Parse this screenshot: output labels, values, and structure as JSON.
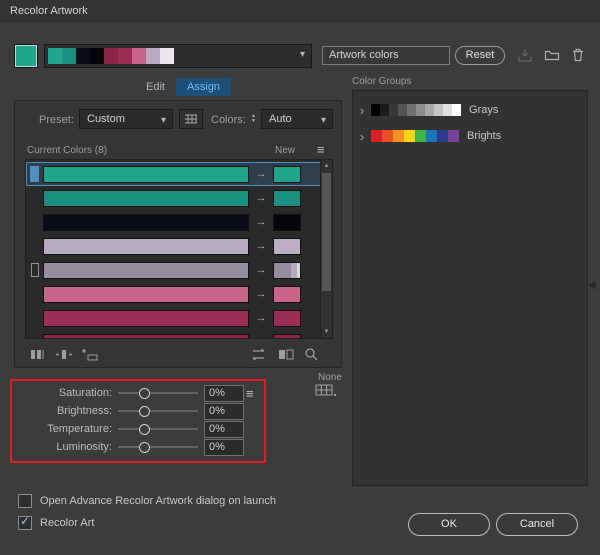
{
  "window": {
    "title": "Recolor Artwork"
  },
  "icons": {
    "row_arrow": "→",
    "menu": "≡",
    "chevron_down": "▾",
    "chevron_right": "›",
    "scroll_up": "▲",
    "scroll_down": "▼",
    "stepper_up": "▲",
    "stepper_down": "▼",
    "collapse_left": "◀",
    "check": "✓"
  },
  "toolbar": {
    "selected_swatch": "#21a48c",
    "palette": [
      "#21a48c",
      "#1b9181",
      "#0a0d17",
      "#04060c",
      "#8e2348",
      "#9c2d56",
      "#c9648b",
      "#b7abc0",
      "#ece7ef"
    ],
    "artwork_colors": "Artwork colors",
    "reset": "Reset"
  },
  "tabs": {
    "edit": "Edit",
    "assign": "Assign"
  },
  "preset": {
    "label": "Preset:",
    "value": "Custom",
    "colors_label": "Colors:",
    "colors_value": "Auto"
  },
  "assign": {
    "header": "Current Colors (8)",
    "new_header": "New",
    "rows": [
      {
        "color": "#21a48c",
        "new": "#21a48c",
        "selected": true
      },
      {
        "color": "#1b9181",
        "new": "#1b9181"
      },
      {
        "color": "#0a0d17",
        "new": "#04060c"
      },
      {
        "color": "#b7abc0",
        "new": "#bcb0c5"
      },
      {
        "color": "#958c9d",
        "new": "#958c9d",
        "split": "#b3a9bb",
        "grip": true
      },
      {
        "color": "#c9648b",
        "new": "#c9648b"
      },
      {
        "color": "#9c2d56",
        "new": "#9c2d56"
      },
      {
        "color": "#8e2348",
        "new": "#8e2348"
      }
    ]
  },
  "sliders": {
    "rows": [
      {
        "label": "Saturation:",
        "value": "0%"
      },
      {
        "label": "Brightness:",
        "value": "0%"
      },
      {
        "label": "Temperature:",
        "value": "0%"
      },
      {
        "label": "Luminosity:",
        "value": "0%"
      }
    ]
  },
  "color_groups": {
    "title": "Color Groups",
    "none_label": "None",
    "groups": [
      {
        "name": "Grays",
        "swatches": [
          "#000000",
          "#1c1c1c",
          "#383838",
          "#545454",
          "#707070",
          "#8c8c8c",
          "#a8a8a8",
          "#c4c4c4",
          "#e0e0e0",
          "#ffffff"
        ]
      },
      {
        "name": "Brights",
        "swatches": [
          "#d92027",
          "#ef4e23",
          "#f7941e",
          "#ffd40e",
          "#3db54a",
          "#1b75bb",
          "#2b3990",
          "#7c4199"
        ]
      }
    ]
  },
  "footer": {
    "launch_label": "Open Advance Recolor Artwork dialog on launch",
    "launch_checked": false,
    "recolor_label": "Recolor Art",
    "recolor_checked": true,
    "ok": "OK",
    "cancel": "Cancel"
  },
  "annotation": {
    "color": "#e31b23"
  }
}
